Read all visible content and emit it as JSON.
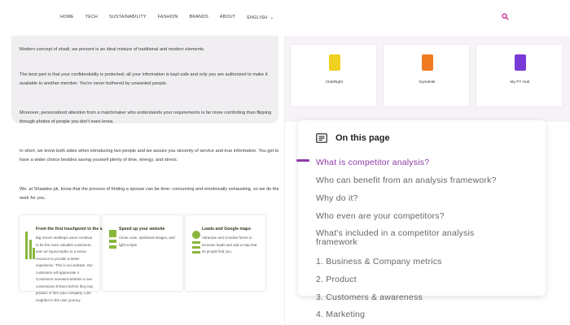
{
  "nav": {
    "items": [
      "HOME",
      "TECH",
      "SUSTAINABILITY",
      "FASHION",
      "BRANDS",
      "ABOUT"
    ],
    "language": "ENGLISH",
    "search_icon": "search-icon"
  },
  "article": {
    "paragraphs": [
      "Modern concept of shadi, we present is an ideal mixture of traditional and modern elements.",
      "The best part is that your confidentiality is protected; all your information is kept safe and only you are authorized to make it available to another member. You're never bothered by unwanted people.",
      "Moreover, personalized attention from a matchmaker who understands your requirements is far more comforting than flipping through photos of people you don't even know.",
      "In short, we know both sides when introducing two people and we assure you sincerity of service and true information. You get to have a wider choice besides saving yourself plenty of time, energy, and stress.",
      "We, at Shaadee.pk, know that the process of finding a spouse can be time- consuming and emotionally exhausting, so we do the work for you."
    ]
  },
  "features": [
    {
      "title": "From the first touchpoint to the sale",
      "desc": "Big screen desktops users continue to be the more valuable customers, and our layout widen to a sense resource to provide a better experience. This is our website. Our customers will appreciate 4 Customers reviewed website to see conversions 8 times before they buy product or hire your company. Lots neighbor in the user journey."
    },
    {
      "title": "Speed up your website",
      "desc": "Clean code, optimised images, and light scripts."
    },
    {
      "title": "Leads and Google maps",
      "desc": "Attractive and Creative forms to increase leads and add a map that let people find you."
    }
  ],
  "apps": [
    {
      "name": "ClubRight",
      "color": "#f0d020"
    },
    {
      "name": "Gymdesk",
      "color": "#f07a20"
    },
    {
      "name": "My PT Hub",
      "color": "#7a3ad8"
    }
  ],
  "toc": {
    "title": "On this page",
    "items": [
      "What is competitor analysis?",
      "Who can benefit from an analysis framework?",
      "Why do it?",
      "Who even are your competitors?",
      "What's included in a competitor analysis framework",
      "1. Business & Company metrics",
      "2. Product",
      "3. Customers & awareness",
      "4. Marketing"
    ],
    "active_color": "#8e3aa6"
  }
}
